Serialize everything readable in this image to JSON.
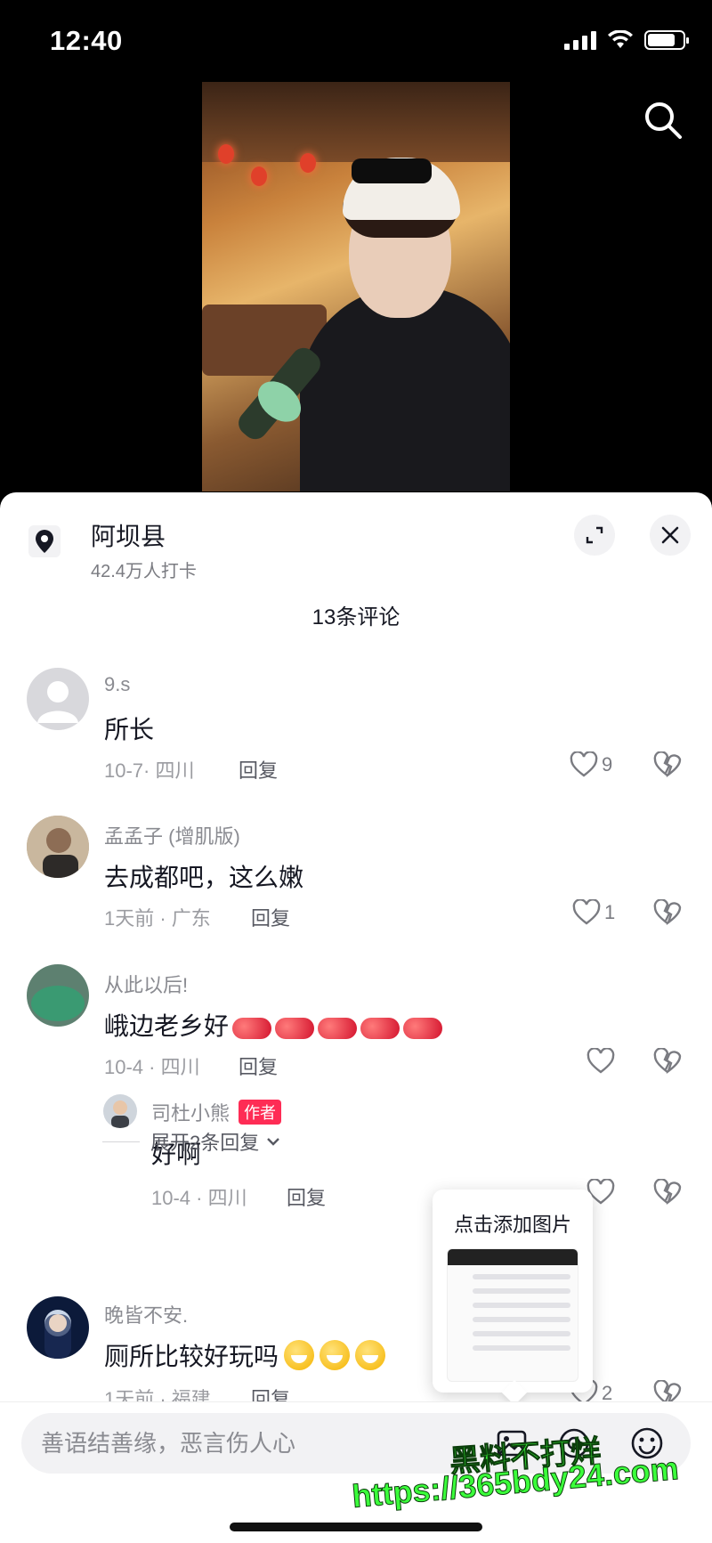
{
  "status_bar": {
    "time": "12:40"
  },
  "location": {
    "title": "阿坝县",
    "checkins": "42.4万人打卡"
  },
  "comments_header": "13条评论",
  "comments": [
    {
      "user": "9.s",
      "text": "所长",
      "meta": "10-7· 四川",
      "reply": "回复",
      "likes": "9"
    },
    {
      "user": "孟孟子 (增肌版)",
      "text": "去成都吧，这么嫩",
      "meta": "1天前 · 广东",
      "reply": "回复",
      "likes": "1"
    },
    {
      "user": "从此以后!",
      "text": "峨边老乡好",
      "meta": "10-4 · 四川",
      "reply": "回复",
      "likes": ""
    },
    {
      "user": "晚皆不安.",
      "text": "厕所比较好玩吗",
      "meta": "1天前 · 福建",
      "reply": "回复",
      "likes": "2"
    }
  ],
  "nested_reply": {
    "user": "司杜小熊",
    "badge": "作者",
    "text": "好啊",
    "meta": "10-4 · 四川",
    "reply": "回复"
  },
  "expand_label": "展开2条回复",
  "popup": {
    "title": "点击添加图片"
  },
  "input": {
    "placeholder": "善语结善缘，恶言伤人心"
  },
  "watermark": {
    "line1": "黑料不打烊",
    "line2": "https://365bdy24.com"
  },
  "colors": {
    "accent": "#fe2c55",
    "muted": "#8a8b91",
    "watermark": "#3bff3b"
  }
}
